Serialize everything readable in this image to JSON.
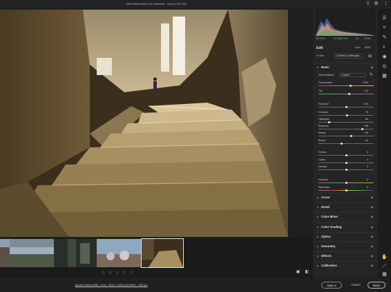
{
  "window": {
    "title": "DSC09626.ARW (1/6 Selected)  -  Sony ILCE-7M3"
  },
  "camera_info": {
    "iso": "ISO 1000",
    "focal": "12-24@12mm",
    "aperture": "f/8",
    "shutter": "1/125s"
  },
  "edit": {
    "title": "Edit",
    "auto_label": "Auto",
    "bw_label": "B&W",
    "profile_label": "Profile",
    "profile_value": "Camera Landscape"
  },
  "basic": {
    "title": "Basic",
    "white_balance_label": "White Balance",
    "white_balance_value": "Custom",
    "sliders": [
      {
        "label": "Temperature",
        "value": "4750",
        "pos": 0.58
      },
      {
        "label": "Tint",
        "value": "+12",
        "pos": 0.56
      },
      {
        "label": "Exposure",
        "value": "0.00",
        "pos": 0.5
      },
      {
        "label": "Contrast",
        "value": "+5",
        "pos": 0.52
      },
      {
        "label": "Highlights",
        "value": "-63",
        "pos": 0.19
      },
      {
        "label": "Shadows",
        "value": "+58",
        "pos": 0.79
      },
      {
        "label": "Whites",
        "value": "+18",
        "pos": 0.59
      },
      {
        "label": "Blacks",
        "value": "-16",
        "pos": 0.42
      },
      {
        "label": "Texture",
        "value": "0",
        "pos": 0.5
      },
      {
        "label": "Clarity",
        "value": "0",
        "pos": 0.5
      },
      {
        "label": "Dehaze",
        "value": "0",
        "pos": 0.5
      },
      {
        "label": "Vibrance",
        "value": "0",
        "pos": 0.5
      },
      {
        "label": "Saturation",
        "value": "0",
        "pos": 0.5
      }
    ]
  },
  "sections": [
    "Curve",
    "Detail",
    "Color Mixer",
    "Color Grading",
    "Optics",
    "Geometry",
    "Effects",
    "Calibration"
  ],
  "rating": {
    "stars": "☆ ☆ ☆ ☆ ☆"
  },
  "footer": {
    "workflow_link": "Adobe RGB (1998) - 8 bit - 6000 x 4000 (24.0MP) - 300 ppi",
    "open_label": "Open",
    "cancel_label": "Cancel",
    "done_label": "Done"
  },
  "colors": {
    "accent": "#1473e6",
    "panel_bg": "#252525"
  }
}
